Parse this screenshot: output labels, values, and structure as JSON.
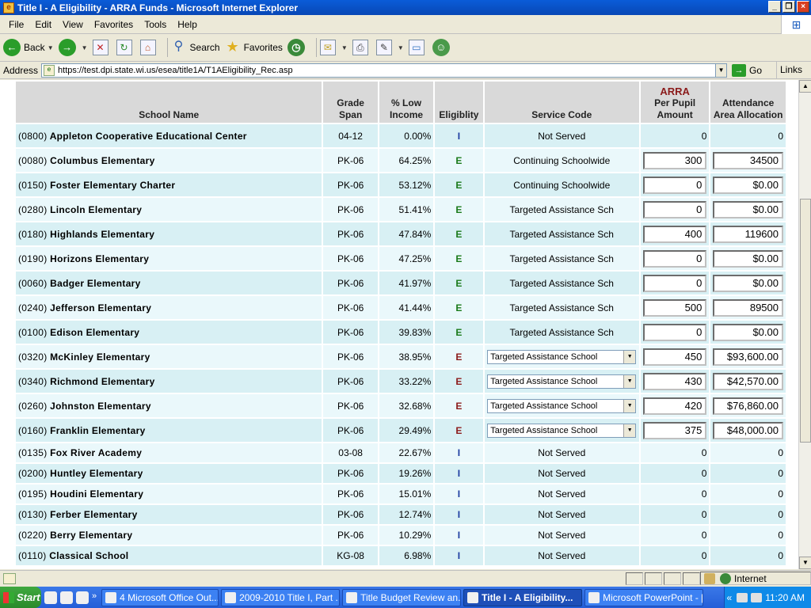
{
  "window": {
    "title": "Title I - A Eligibility - ARRA Funds - Microsoft Internet Explorer"
  },
  "menu": [
    "File",
    "Edit",
    "View",
    "Favorites",
    "Tools",
    "Help"
  ],
  "toolbar": {
    "back": "Back",
    "search": "Search",
    "favorites": "Favorites"
  },
  "address": {
    "label": "Address",
    "url": "https://test.dpi.state.wi.us/esea/title1A/T1AEligibility_Rec.asp",
    "go": "Go",
    "links": "Links"
  },
  "table": {
    "headers": {
      "school_name": "School Name",
      "grade_span": "Grade Span",
      "low_income": "% Low Income",
      "eligibility": "Eligiblity",
      "service_code": "Service Code",
      "arra": "ARRA",
      "per_pupil": "Per Pupil Amount",
      "attendance": "Attendance Area Allocation"
    },
    "rows": [
      {
        "code": "(0800)",
        "name": "Appleton Cooperative Educational Center",
        "grade": "04-12",
        "pct": "0.00%",
        "elig": "I",
        "elig_color": "#1a3aa0",
        "service": "Not Served",
        "service_type": "text",
        "per_pupil": "0",
        "pp_type": "text",
        "allocation": "0",
        "al_type": "text"
      },
      {
        "code": "(0080)",
        "name": "Columbus Elementary",
        "grade": "PK-06",
        "pct": "64.25%",
        "elig": "E",
        "elig_color": "#1a7a1a",
        "service": "Continuing Schoolwide",
        "service_type": "text",
        "per_pupil": "300",
        "pp_type": "input",
        "allocation": "34500",
        "al_type": "input"
      },
      {
        "code": "(0150)",
        "name": "Foster Elementary Charter",
        "grade": "PK-06",
        "pct": "53.12%",
        "elig": "E",
        "elig_color": "#1a7a1a",
        "service": "Continuing Schoolwide",
        "service_type": "text",
        "per_pupil": "0",
        "pp_type": "input",
        "allocation": "$0.00",
        "al_type": "input"
      },
      {
        "code": "(0280)",
        "name": "Lincoln Elementary",
        "grade": "PK-06",
        "pct": "51.41%",
        "elig": "E",
        "elig_color": "#1a7a1a",
        "service": "Targeted Assistance Sch",
        "service_type": "text",
        "per_pupil": "0",
        "pp_type": "input",
        "allocation": "$0.00",
        "al_type": "input"
      },
      {
        "code": "(0180)",
        "name": "Highlands Elementary",
        "grade": "PK-06",
        "pct": "47.84%",
        "elig": "E",
        "elig_color": "#1a7a1a",
        "service": "Targeted Assistance Sch",
        "service_type": "text",
        "per_pupil": "400",
        "pp_type": "input",
        "allocation": "119600",
        "al_type": "input"
      },
      {
        "code": "(0190)",
        "name": "Horizons Elementary",
        "grade": "PK-06",
        "pct": "47.25%",
        "elig": "E",
        "elig_color": "#1a7a1a",
        "service": "Targeted Assistance Sch",
        "service_type": "text",
        "per_pupil": "0",
        "pp_type": "input",
        "allocation": "$0.00",
        "al_type": "input"
      },
      {
        "code": "(0060)",
        "name": "Badger Elementary",
        "grade": "PK-06",
        "pct": "41.97%",
        "elig": "E",
        "elig_color": "#1a7a1a",
        "service": "Targeted Assistance Sch",
        "service_type": "text",
        "per_pupil": "0",
        "pp_type": "input",
        "allocation": "$0.00",
        "al_type": "input"
      },
      {
        "code": "(0240)",
        "name": "Jefferson Elementary",
        "grade": "PK-06",
        "pct": "41.44%",
        "elig": "E",
        "elig_color": "#1a7a1a",
        "service": "Targeted Assistance Sch",
        "service_type": "text",
        "per_pupil": "500",
        "pp_type": "input",
        "allocation": "89500",
        "al_type": "input"
      },
      {
        "code": "(0100)",
        "name": "Edison Elementary",
        "grade": "PK-06",
        "pct": "39.83%",
        "elig": "E",
        "elig_color": "#1a7a1a",
        "service": "Targeted Assistance Sch",
        "service_type": "text",
        "per_pupil": "0",
        "pp_type": "input",
        "allocation": "$0.00",
        "al_type": "input"
      },
      {
        "code": "(0320)",
        "name": "McKinley Elementary",
        "grade": "PK-06",
        "pct": "38.95%",
        "elig": "E",
        "elig_color": "#8b1a1a",
        "service": "Targeted Assistance School",
        "service_type": "select",
        "per_pupil": "450",
        "pp_type": "input",
        "allocation": "$93,600.00",
        "al_type": "input"
      },
      {
        "code": "(0340)",
        "name": "Richmond Elementary",
        "grade": "PK-06",
        "pct": "33.22%",
        "elig": "E",
        "elig_color": "#8b1a1a",
        "service": "Targeted Assistance School",
        "service_type": "select",
        "per_pupil": "430",
        "pp_type": "input",
        "allocation": "$42,570.00",
        "al_type": "input"
      },
      {
        "code": "(0260)",
        "name": "Johnston Elementary",
        "grade": "PK-06",
        "pct": "32.68%",
        "elig": "E",
        "elig_color": "#8b1a1a",
        "service": "Targeted Assistance School",
        "service_type": "select",
        "per_pupil": "420",
        "pp_type": "input",
        "allocation": "$76,860.00",
        "al_type": "input"
      },
      {
        "code": "(0160)",
        "name": "Franklin Elementary",
        "grade": "PK-06",
        "pct": "29.49%",
        "elig": "E",
        "elig_color": "#8b1a1a",
        "service": "Targeted Assistance School",
        "service_type": "select",
        "per_pupil": "375",
        "pp_type": "input",
        "allocation": "$48,000.00",
        "al_type": "input"
      },
      {
        "code": "(0135)",
        "name": "Fox River Academy",
        "grade": "03-08",
        "pct": "22.67%",
        "elig": "I",
        "elig_color": "#1a3aa0",
        "service": "Not Served",
        "service_type": "text",
        "per_pupil": "0",
        "pp_type": "text",
        "allocation": "0",
        "al_type": "text"
      },
      {
        "code": "(0200)",
        "name": "Huntley Elementary",
        "grade": "PK-06",
        "pct": "19.26%",
        "elig": "I",
        "elig_color": "#1a3aa0",
        "service": "Not Served",
        "service_type": "text",
        "per_pupil": "0",
        "pp_type": "text",
        "allocation": "0",
        "al_type": "text"
      },
      {
        "code": "(0195)",
        "name": "Houdini Elementary",
        "grade": "PK-06",
        "pct": "15.01%",
        "elig": "I",
        "elig_color": "#1a3aa0",
        "service": "Not Served",
        "service_type": "text",
        "per_pupil": "0",
        "pp_type": "text",
        "allocation": "0",
        "al_type": "text"
      },
      {
        "code": "(0130)",
        "name": "Ferber Elementary",
        "grade": "PK-06",
        "pct": "12.74%",
        "elig": "I",
        "elig_color": "#1a3aa0",
        "service": "Not Served",
        "service_type": "text",
        "per_pupil": "0",
        "pp_type": "text",
        "allocation": "0",
        "al_type": "text"
      },
      {
        "code": "(0220)",
        "name": "Berry Elementary",
        "grade": "PK-06",
        "pct": "10.29%",
        "elig": "I",
        "elig_color": "#1a3aa0",
        "service": "Not Served",
        "service_type": "text",
        "per_pupil": "0",
        "pp_type": "text",
        "allocation": "0",
        "al_type": "text"
      },
      {
        "code": "(0110)",
        "name": "Classical School",
        "grade": "KG-08",
        "pct": "6.98%",
        "elig": "I",
        "elig_color": "#1a3aa0",
        "service": "Not Served",
        "service_type": "text",
        "per_pupil": "0",
        "pp_type": "text",
        "allocation": "0",
        "al_type": "text"
      }
    ]
  },
  "statusbar": {
    "zone": "Internet"
  },
  "taskbar": {
    "start": "Start",
    "tasks": [
      {
        "label": "4 Microsoft Office Out...",
        "active": false
      },
      {
        "label": "2009-2010 Title I, Part ...",
        "active": false
      },
      {
        "label": "Title Budget Review an...",
        "active": false
      },
      {
        "label": "Title I - A Eligibility...",
        "active": true
      },
      {
        "label": "Microsoft PowerPoint - [...",
        "active": false
      }
    ],
    "clock": "11:20 AM"
  }
}
